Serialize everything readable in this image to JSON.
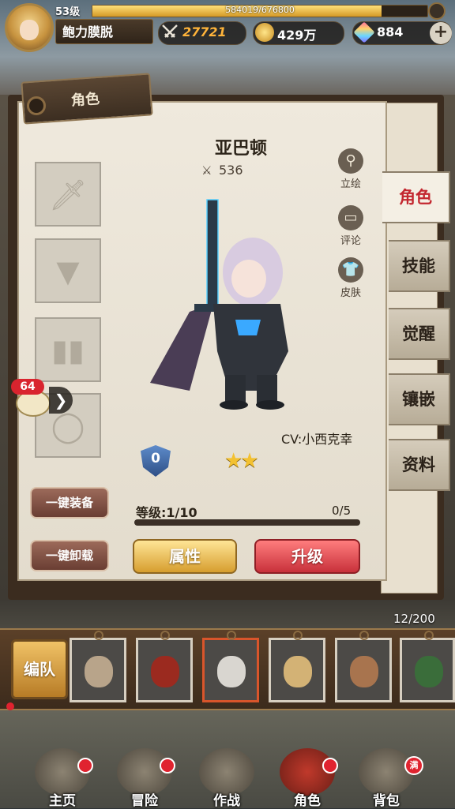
{
  "player": {
    "level": "53级",
    "name": "鲍力膜脱",
    "exp_text": "584019/676800",
    "exp_fraction": 0.863,
    "power": "27721",
    "gold": "429万",
    "gems": "884",
    "plus": "+"
  },
  "panel": {
    "title": "角色",
    "hero_name": "亚巴顿",
    "hero_power": "536",
    "cv": "CV:小西克幸",
    "rank": "0",
    "stars": 2,
    "side_icons": [
      {
        "label": "立绘",
        "icon": "magnifier-icon"
      },
      {
        "label": "评论",
        "icon": "comment-icon"
      },
      {
        "label": "皮肤",
        "icon": "shirt-icon"
      }
    ],
    "equip_slots": [
      "sword-icon",
      "armor-icon",
      "boots-icon",
      "necklace-icon"
    ],
    "equip_all": "一键装备",
    "unequip_all": "一键卸载",
    "level_label": "等级:1/10",
    "level_frac": "0/5",
    "level_fraction": 0.0,
    "attr_button": "属性",
    "upgrade_button": "升级"
  },
  "tabs": [
    "角色",
    "技能",
    "觉醒",
    "镶嵌",
    "资料"
  ],
  "chat": {
    "badge": "64",
    "arrow": "❯"
  },
  "team": {
    "count": "12/200",
    "button": "编队",
    "cards": [
      {
        "color": "#b8a48a"
      },
      {
        "color": "#9b2a1f"
      },
      {
        "color": "#d9d6d0"
      },
      {
        "color": "#d3b275"
      },
      {
        "color": "#a8744e"
      },
      {
        "color": "#3a6d3a"
      }
    ]
  },
  "nav": [
    {
      "label": "主页",
      "badge": "dot"
    },
    {
      "label": "冒险",
      "badge": "dot"
    },
    {
      "label": "作战",
      "badge": ""
    },
    {
      "label": "角色",
      "badge": "dot"
    },
    {
      "label": "背包",
      "badge": "满"
    }
  ]
}
